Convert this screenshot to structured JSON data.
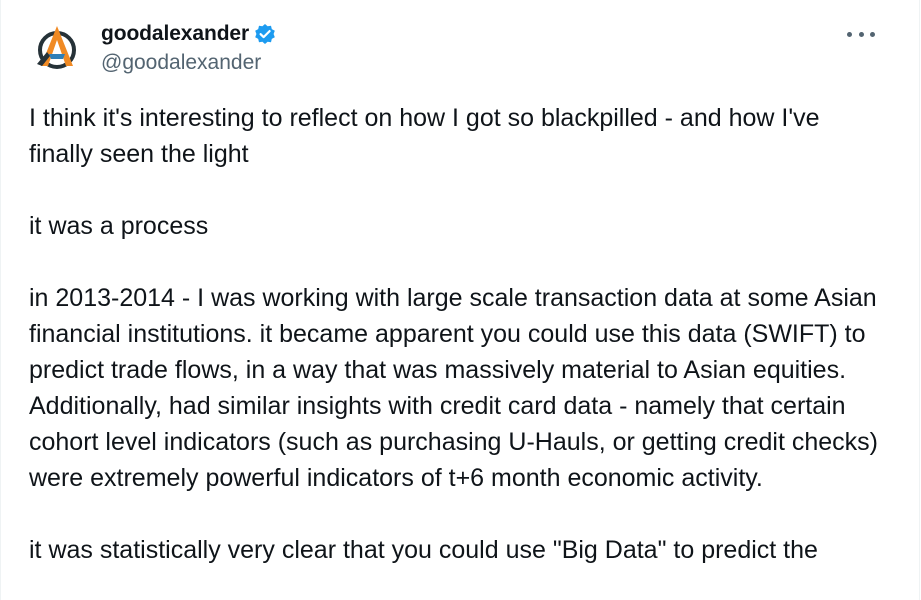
{
  "author": {
    "display_name": "goodalexander",
    "handle": "@goodalexander",
    "verified": true
  },
  "colors": {
    "text": "#0f1419",
    "secondary": "#536471",
    "verified_blue": "#1d9bf0",
    "logo_orange": "#f08a24",
    "logo_dark": "#263238",
    "logo_blue": "#2f7fb8"
  },
  "icons": {
    "more": "more-horizontal-icon",
    "verified": "verified-badge-icon",
    "avatar": "logo-a-avatar"
  },
  "tweet": {
    "paragraphs": [
      "I think it's interesting to reflect on how I got so blackpilled - and how I've finally seen the light",
      "it was a process",
      "in 2013-2014 - I was working with large scale transaction data at some Asian financial institutions. it became apparent you could use this data (SWIFT) to predict trade flows, in a way that was massively material to Asian equities. Additionally, had similar insights with credit card data - namely that certain cohort level indicators (such as purchasing U-Hauls, or getting credit checks) were extremely powerful indicators of t+6 month economic activity.",
      "it was statistically very clear that you could use \"Big Data\" to predict the"
    ]
  }
}
